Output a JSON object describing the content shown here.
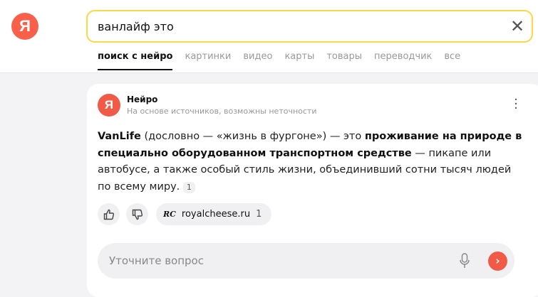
{
  "header": {
    "logo": "Я",
    "search_value": "ванлайф это",
    "clear_icon": "close-icon"
  },
  "tabs": [
    {
      "label": "поиск с нейро",
      "active": true
    },
    {
      "label": "картинки"
    },
    {
      "label": "видео"
    },
    {
      "label": "карты"
    },
    {
      "label": "товары"
    },
    {
      "label": "переводчик"
    },
    {
      "label": "все"
    }
  ],
  "neuro": {
    "logo": "Я",
    "title": "Нейро",
    "subtitle": "На основе источников, возможны неточности",
    "answer": {
      "p1": "VanLife",
      "p2": " (дословно — «жизнь в фургоне») — это ",
      "p3": "проживание на природе в специально оборудованном транспортном средстве",
      "p4": " — пикапе или автобусе, а также особый стиль жизни, объединивший сотни тысяч людей по всему миру.",
      "ref": "1"
    },
    "source": {
      "icon": "RC",
      "domain": "royalcheese.ru",
      "count": "1"
    },
    "ask_placeholder": "Уточните вопрос",
    "send": "›"
  },
  "colors": {
    "accent": "#f15a47",
    "search_border": "#fdd844"
  }
}
